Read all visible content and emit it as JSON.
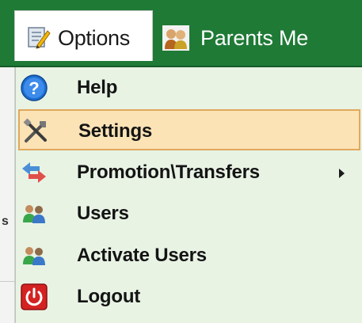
{
  "menubar": {
    "options_label": "Options",
    "options_icon": "notepad-edit-icon",
    "parents_label": "Parents Me",
    "parents_icon": "people-icon"
  },
  "background": {
    "partial_text": "s"
  },
  "dropdown": {
    "items": [
      {
        "label": "Help",
        "icon": "help-icon",
        "selected": false,
        "submenu": false
      },
      {
        "label": "Settings",
        "icon": "tools-icon",
        "selected": true,
        "submenu": false
      },
      {
        "label": "Promotion\\Transfers",
        "icon": "transfer-arrows-icon",
        "selected": false,
        "submenu": true
      },
      {
        "label": "Users",
        "icon": "users-icon",
        "selected": false,
        "submenu": false
      },
      {
        "label": "Activate Users",
        "icon": "activate-users-icon",
        "selected": false,
        "submenu": false
      },
      {
        "label": "Logout",
        "icon": "power-icon",
        "selected": false,
        "submenu": false
      }
    ]
  },
  "colors": {
    "menubar_bg": "#1f7a36",
    "dropdown_bg": "#e8f3e4",
    "selected_bg": "#fbe3b6",
    "selected_border": "#e0a85c"
  }
}
